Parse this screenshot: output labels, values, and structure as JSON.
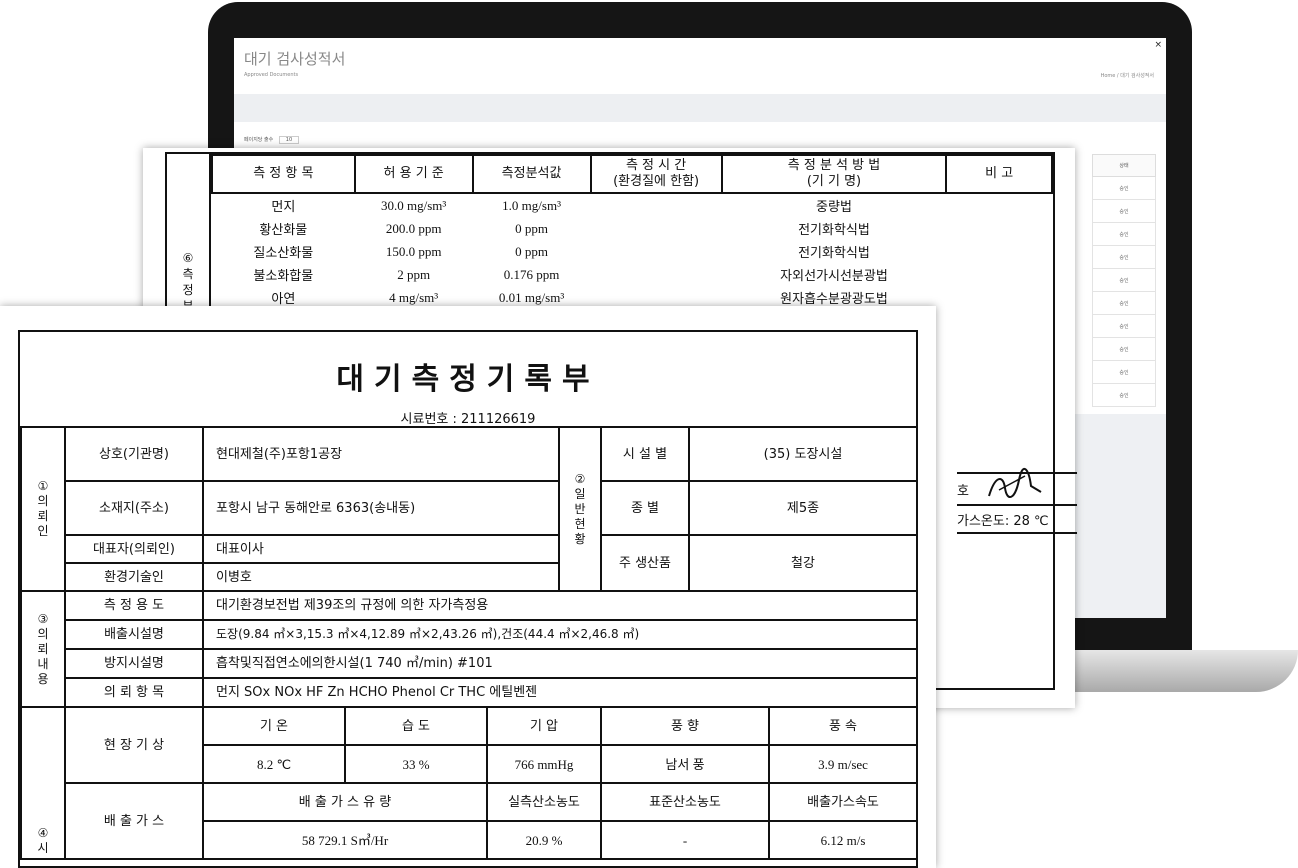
{
  "screen": {
    "title": "대기 검사성적서",
    "subtitle": "Approved Documents",
    "breadcrumb": "Home / 대기 검사성적서",
    "filter_label": "페이지당 출수",
    "filter_value": "10",
    "close_glyph": "×",
    "table_header": "상태",
    "table_rows": [
      "승인",
      "승인",
      "승인",
      "승인",
      "승인",
      "승인",
      "승인",
      "승인",
      "승인",
      "승인"
    ]
  },
  "back_doc": {
    "side_label_num": "⑥",
    "side_label_text": "측정부",
    "headers": [
      "측 정 항 목",
      "허 용 기 준",
      "측정분석값",
      "측 정 시 간\n(환경질에 한함)",
      "측 정 분 석 방 법\n(기 기 명)",
      "비 고"
    ],
    "rows": [
      {
        "item": "먼지",
        "limit": "30.0 mg/sm³",
        "value": "1.0 mg/sm³",
        "time": "",
        "method": "중량법",
        "note": ""
      },
      {
        "item": "황산화물",
        "limit": "200.0 ppm",
        "value": "0 ppm",
        "time": "",
        "method": "전기화학식법",
        "note": ""
      },
      {
        "item": "질소산화물",
        "limit": "150.0 ppm",
        "value": "0 ppm",
        "time": "",
        "method": "전기화학식법",
        "note": ""
      },
      {
        "item": "불소화합물",
        "limit": "2 ppm",
        "value": "0.176 ppm",
        "time": "",
        "method": "자외선가시선분광법",
        "note": ""
      },
      {
        "item": "아연",
        "limit": "4 mg/sm³",
        "value": "0.01 mg/sm³",
        "time": "",
        "method": "원자흡수분광광도법",
        "note": ""
      }
    ],
    "sign_text": "호",
    "temp_text": "가스온도: 28 ℃"
  },
  "front_doc": {
    "title": "대기측정기록부",
    "sample_no": "시료번호 : 211126619",
    "sec1_label": "①\n의\n뢰\n인",
    "sec2_label": "②\n일\n반\n현\n황",
    "sec3_label": "③\n의\n뢰\n내\n용",
    "sec4_label": "④\n시",
    "company_label": "상호(기관명)",
    "company_value": "현대제철(주)포항1공장",
    "address_label": "소재지(주소)",
    "address_value": "포항시 남구 동해안로 6363(송내동)",
    "rep_label": "대표자(의뢰인)",
    "rep_value": "대표이사",
    "engineer_label": "환경기술인",
    "engineer_value": "이병호",
    "facility_type_label": "시 설 별",
    "facility_type_value": "(35) 도장시설",
    "category_label": "종 별",
    "category_value": "제5종",
    "product_label": "주 생산품",
    "product_value": "철강",
    "purpose_label": "측 정 용 도",
    "purpose_value": "대기환경보전법 제39조의 규정에 의한 자가측정용",
    "emission_label": "배출시설명",
    "emission_value": "도장(9.84 ㎥×3,15.3 ㎥×4,12.89 ㎥×2,43.26 ㎥),건조(44.4 ㎥×2,46.8 ㎥)",
    "prevention_label": "방지시설명",
    "prevention_value": "흡착및직접연소에의한시설(1 740 ㎥/min) #101",
    "items_label": "의 뢰 항 목",
    "items_value": "먼지 SOx NOx HF Zn HCHO Phenol Cr THC 에틸벤젠",
    "weather_label": "현 장 기 상",
    "weather_headers": [
      "기 온",
      "습 도",
      "기 압",
      "풍 향",
      "풍 속"
    ],
    "weather_values": [
      "8.2 ℃",
      "33 %",
      "766 mmHg",
      "남서 풍",
      "3.9 m/sec"
    ],
    "gas_label": "배 출 가 스",
    "gas_headers": [
      "배 출 가 스 유 량",
      "실측산소농도",
      "표준산소농도",
      "배출가스속도"
    ],
    "gas_values": [
      "58 729.1 S㎥/Hr",
      "20.9 %",
      "-",
      "6.12 m/s"
    ]
  }
}
